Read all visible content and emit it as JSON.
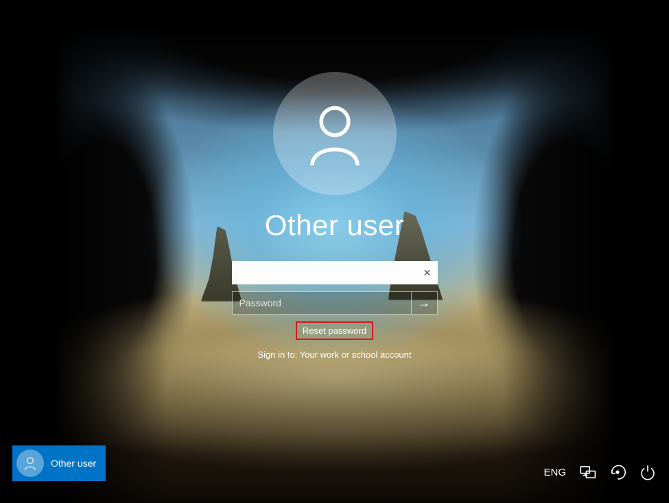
{
  "login": {
    "user_title": "Other user",
    "username_value": "",
    "password_placeholder": "Password",
    "reset_label": "Reset password",
    "signin_hint": "Sign in to: Your work or school account"
  },
  "bottom_left": {
    "label": "Other user"
  },
  "bottom_right": {
    "language": "ENG"
  },
  "icons": {
    "user": "user-icon",
    "clear": "close-icon",
    "submit": "arrow-right-icon",
    "network": "network-icon",
    "ease": "ease-of-access-icon",
    "power": "power-icon"
  },
  "colors": {
    "accent": "#0173c7",
    "highlight_border": "#d21a1a"
  }
}
